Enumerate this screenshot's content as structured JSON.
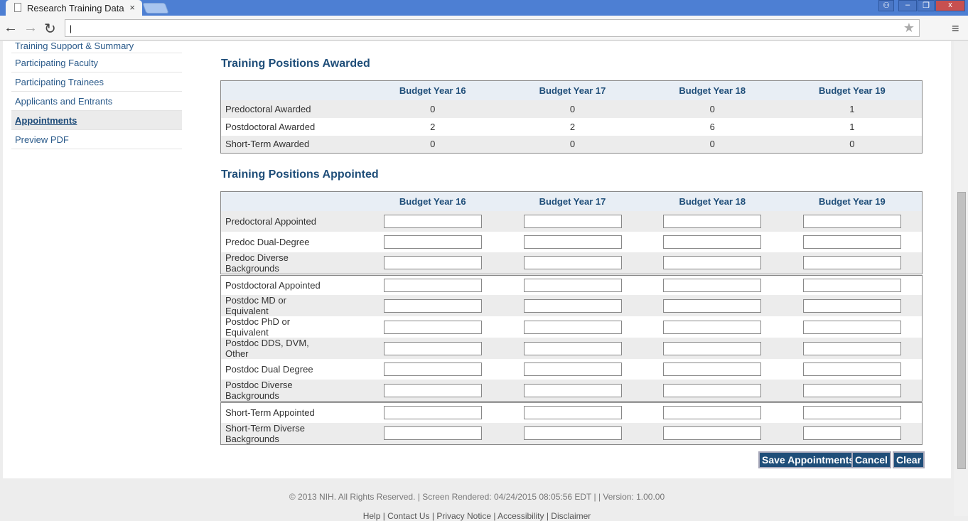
{
  "browser": {
    "tab_title": "Research Training Data",
    "close": "×",
    "address": "|",
    "star": "★",
    "menu": "≡",
    "back": "←",
    "forward": "→",
    "reload": "↻"
  },
  "sidebar": {
    "items": [
      {
        "label": "Training Support & Summary"
      },
      {
        "label": "Participating Faculty"
      },
      {
        "label": "Participating Trainees"
      },
      {
        "label": "Applicants and Entrants"
      },
      {
        "label": "Appointments",
        "active": true
      },
      {
        "label": "Preview PDF"
      }
    ]
  },
  "awarded": {
    "title": "Training Positions Awarded",
    "headers": [
      "",
      "Budget Year 16",
      "Budget Year 17",
      "Budget Year 18",
      "Budget Year 19"
    ],
    "rows": [
      {
        "label": "Predoctoral Awarded",
        "values": [
          "0",
          "0",
          "0",
          "1"
        ]
      },
      {
        "label": "Postdoctoral Awarded",
        "values": [
          "2",
          "2",
          "6",
          "1"
        ]
      },
      {
        "label": "Short-Term Awarded",
        "values": [
          "0",
          "0",
          "0",
          "0"
        ]
      }
    ]
  },
  "appointed": {
    "title": "Training Positions Appointed",
    "headers": [
      "",
      "Budget Year 16",
      "Budget Year 17",
      "Budget Year 18",
      "Budget Year 19"
    ],
    "rows": [
      {
        "label": "Predoctoral Appointed"
      },
      {
        "label": "Predoc Dual-Degree"
      },
      {
        "label": "Predoc Diverse Backgrounds"
      },
      {
        "label": "Postdoctoral Appointed",
        "sep": true
      },
      {
        "label": "Postdoc MD or Equivalent"
      },
      {
        "label": "Postdoc PhD or Equivalent"
      },
      {
        "label": "Postdoc DDS, DVM, Other"
      },
      {
        "label": "Postdoc Dual Degree"
      },
      {
        "label": "Postdoc Diverse Backgrounds"
      },
      {
        "label": "Short-Term Appointed",
        "sep": true
      },
      {
        "label": "Short-Term Diverse Backgrounds"
      }
    ]
  },
  "buttons": {
    "save": "Save Appointments",
    "cancel": "Cancel",
    "clear": "Clear"
  },
  "footer": {
    "text": "© 2013 NIH. All Rights Reserved. | Screen Rendered: 04/24/2015 08:05:56 EDT | | Version: 1.00.00",
    "links": [
      "Help",
      "Contact Us",
      "Privacy Notice",
      "Accessibility",
      "Disclaimer"
    ]
  }
}
